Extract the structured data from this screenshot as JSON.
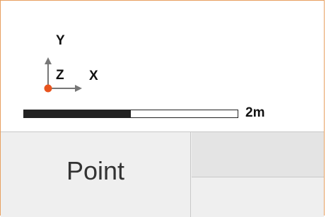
{
  "axes": {
    "y_label": "Y",
    "z_label": "Z",
    "x_label": "X",
    "origin_color": "#e8541e",
    "arrow_color": "#777777"
  },
  "scale": {
    "label": "2m",
    "filled_fraction": 0.5
  },
  "toolbar": {
    "point_label": "Point"
  }
}
